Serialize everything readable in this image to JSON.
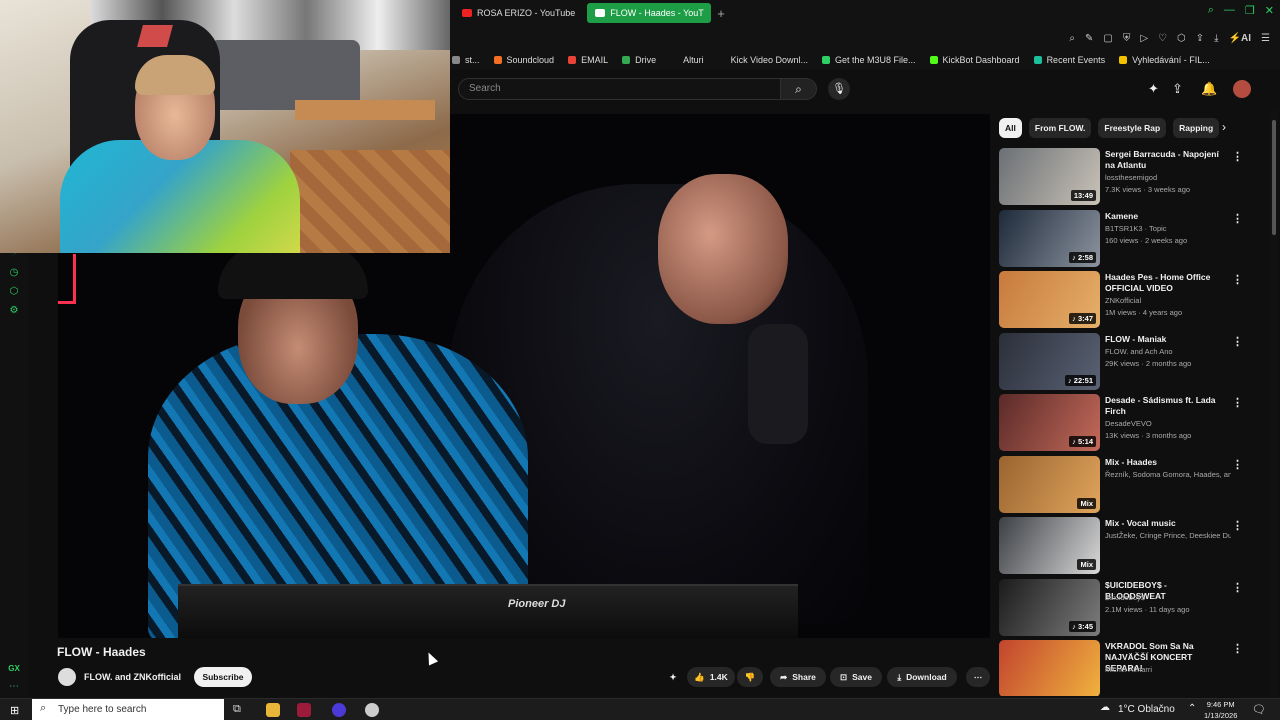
{
  "browser": {
    "tabs": [
      {
        "label": "ROSA ERIZO - YouTube",
        "active": false
      },
      {
        "label": "FLOW - Haades - YouT",
        "active": true
      }
    ],
    "new_tab": "+",
    "toolbar_icons": [
      "zoom-icon",
      "pin-icon",
      "screenshot-icon",
      "shield-icon",
      "play-icon",
      "heart-icon",
      "extensions-icon",
      "share-icon",
      "download-icon",
      "ai-icon",
      "menu-icon"
    ],
    "ai_label": "AI",
    "window_controls": [
      "search-icon",
      "minimize-icon",
      "restore-icon",
      "close-icon"
    ]
  },
  "bookmarks": [
    {
      "label": "st...",
      "color": "#888888"
    },
    {
      "label": "Soundcloud",
      "color": "#f26f23"
    },
    {
      "label": "EMAIL",
      "color": "#ea4335"
    },
    {
      "label": "Drive",
      "color": "#34a853"
    },
    {
      "label": "Alturi",
      "color": "#121212"
    },
    {
      "label": "Kick Video Downl...",
      "color": "#121212"
    },
    {
      "label": "Get the M3U8 File...",
      "color": "#2ecf64"
    },
    {
      "label": "KickBot Dashboard",
      "color": "#53fc18"
    },
    {
      "label": "Recent Events",
      "color": "#1bbf9c"
    },
    {
      "label": "Vyhledávání - FIL...",
      "color": "#f2c200"
    }
  ],
  "gx_sidebar": {
    "label": "GX"
  },
  "youtube": {
    "search_placeholder": "Search",
    "video": {
      "title": "FLOW - Haades",
      "deck_label": "Pioneer DJ",
      "channel": "FLOW. and ZNKofficial",
      "subscribe": "Subscribe",
      "likes": "1.4K",
      "share": "Share",
      "save": "Save",
      "download": "Download"
    },
    "chips": [
      {
        "label": "All",
        "active": true
      },
      {
        "label": "From FLOW.",
        "active": false
      },
      {
        "label": "Freestyle Rap",
        "active": false
      },
      {
        "label": "Rapping",
        "active": false
      }
    ],
    "related": [
      {
        "title": "Sergei Barracuda - Napojení na Atlantu",
        "channel": "lossthesemigod",
        "meta": "7.3K views · 3 weeks ago",
        "duration": "13:49",
        "colors": [
          "#6b6f74",
          "#c9c3b8"
        ]
      },
      {
        "title": "Kamene",
        "channel": "B1TSR1K3 · Topic",
        "meta": "160 views · 2 weeks ago",
        "duration": "♪ 2:58",
        "colors": [
          "#1e2a3a",
          "#8d94a0"
        ]
      },
      {
        "title": "Haades Pes - Home Office OFFICIAL VIDEO",
        "channel": "ZNKofficial",
        "meta": "1M views · 4 years ago",
        "duration": "♪ 3:47",
        "colors": [
          "#c77a3c",
          "#e6b06a"
        ]
      },
      {
        "title": "FLOW - Maniak",
        "channel": "FLOW. and Ach Ano",
        "meta": "29K views · 2 months ago",
        "duration": "♪ 22:51",
        "colors": [
          "#2b2f3a",
          "#5a6274"
        ]
      },
      {
        "title": "Desade - Sádismus ft. Lada Firch",
        "channel": "DesadeVEVO",
        "meta": "13K views · 3 months ago",
        "duration": "♪ 5:14",
        "colors": [
          "#5a2a28",
          "#c46a5a"
        ]
      },
      {
        "title": "Mix - Haades",
        "channel": "Řezník, Sodoma Gomora, Haades, and m...",
        "meta": "",
        "duration": "Mix",
        "colors": [
          "#9a6430",
          "#e0a55c"
        ]
      },
      {
        "title": "Mix - Vocal music",
        "channel": "JustŽeke, Cringe Prince, Deeskiee Dub, a...",
        "meta": "",
        "duration": "Mix",
        "colors": [
          "#3c3f44",
          "#d9d9d9"
        ]
      },
      {
        "title": "$UICIDEBOY$ - BLOODSWEAT",
        "channel": "$uicideboy$",
        "meta": "2.1M views · 11 days ago",
        "duration": "♪ 3:45",
        "colors": [
          "#1b1b1b",
          "#7d7d7d"
        ]
      },
      {
        "title": "VKRADOL Som Sa Na NAJVÄČŠÍ KONCERT SEPARA!",
        "channel": "Michel Almarri",
        "meta": "",
        "duration": "",
        "colors": [
          "#c2442e",
          "#f0b23e"
        ]
      }
    ]
  },
  "taskbar": {
    "search_placeholder": "Type here to search",
    "weather": "1°C  Oblačno",
    "time": "9:46 PM",
    "date": "1/13/2026"
  }
}
